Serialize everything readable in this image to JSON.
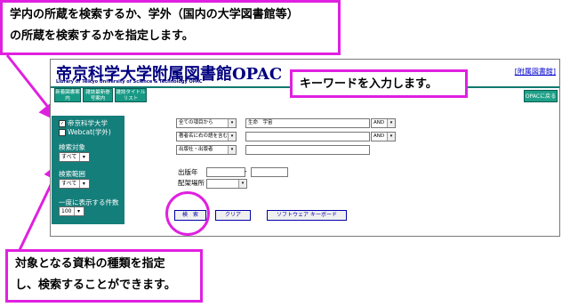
{
  "callouts": {
    "top_left_line1": "学内の所蔵を検索するか、学外（国内の大学図書館等）",
    "top_left_line2": "の所蔵を検索するかを指定します。",
    "keyword": "キーワードを入力します。",
    "bottom_line1": "対象となる資料の種類を指定",
    "bottom_line2": "し、検索することができます。"
  },
  "header": {
    "title": "帝京科学大学附属図書館OPAC",
    "subtitle": "Library of Teikyo University of Science & Technology OPAC",
    "right_link": "[附属図書館]",
    "opac_back": "OPACに戻る"
  },
  "nav": {
    "new_books": "新着図書案内",
    "journal_issues": "雑誌最新巻号案内",
    "journal_titles": "雑誌タイトルリスト"
  },
  "sidebar": {
    "target_local": "帝京科学大学",
    "target_webcat": "Webcat(学外)",
    "material_label": "検索対象",
    "material_value": "すべて",
    "scope_label": "検索範囲",
    "scope_value": "すべて",
    "per_page_label": "一度に表示する件数",
    "per_page_value": "100"
  },
  "form": {
    "field1": "全ての項目から",
    "field1_value": "生命　宇宙",
    "op1": "AND",
    "field2": "著者名に右の語を含む",
    "op2": "AND",
    "field3": "出版社・出版者",
    "pub_year_label": "出版年",
    "pub_year_sep": "-",
    "location_label": "配架場所",
    "search_button": "検　索",
    "clear_button": "クリア",
    "keyboard_button": "ソフトウェア キーボード"
  },
  "colors": {
    "callout_border": "#e020e0",
    "panel_teal": "#147e7a",
    "title_blue": "#000080"
  }
}
